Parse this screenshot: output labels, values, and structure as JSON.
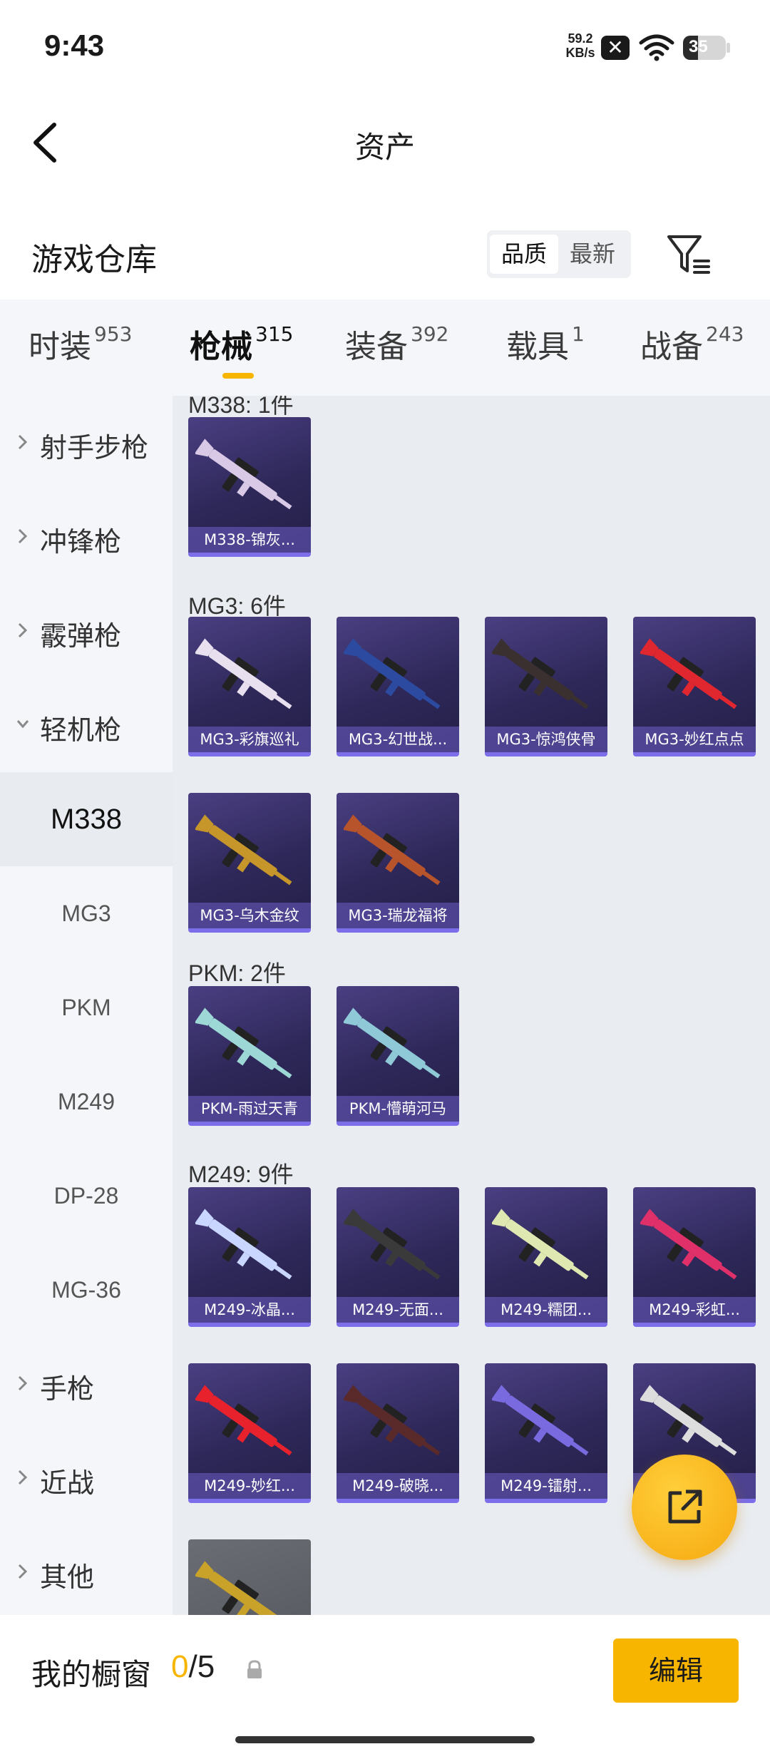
{
  "status_bar": {
    "time": "9:43",
    "net_speed_value": "59.2",
    "net_speed_unit": "KB/s",
    "battery": "35",
    "battery_level": 0.35
  },
  "nav": {
    "title": "资产",
    "back_icon": "chevron-left-icon"
  },
  "section": {
    "title": "游戏仓库",
    "sort_options": [
      "品质",
      "最新"
    ],
    "active_sort": "品质",
    "filter_icon": "filter-icon"
  },
  "tabs": [
    {
      "label": "时装",
      "count": "953"
    },
    {
      "label": "枪械",
      "count": "315"
    },
    {
      "label": "装备",
      "count": "392"
    },
    {
      "label": "载具",
      "count": "1"
    },
    {
      "label": "战备",
      "count": "243"
    }
  ],
  "active_tab": "枪械",
  "sidebar": {
    "categories": [
      "射手步枪",
      "冲锋枪",
      "霰弹枪",
      "轻机枪"
    ],
    "subcategories": [
      "M338",
      "MG3",
      "PKM",
      "M249",
      "DP-28",
      "MG-36"
    ],
    "active_sub": "M338",
    "more_categories": [
      "手枪",
      "近战",
      "其他"
    ]
  },
  "groups": [
    {
      "title": "M338: 1件",
      "items": [
        "M338-锦灰..."
      ]
    },
    {
      "title": "MG3: 6件",
      "items": [
        "MG3-彩旗巡礼",
        "MG3-幻世战...",
        "MG3-惊鸿侠骨",
        "MG3-妙红点点",
        "MG3-乌木金纹",
        "MG3-瑞龙福将"
      ]
    },
    {
      "title": "PKM: 2件",
      "items": [
        "PKM-雨过天青",
        "PKM-懵萌河马"
      ]
    },
    {
      "title": "M249: 9件",
      "items": [
        "M249-冰晶...",
        "M249-无面...",
        "M249-糯团...",
        "M249-彩虹...",
        "M249-妙红...",
        "M249-破晓...",
        "M249-镭射...",
        "",
        ""
      ]
    }
  ],
  "gun_colors": {
    "m338": "#d9c9e6",
    "mg3": [
      "#e8e0ee",
      "#2b4aa0",
      "#3a3030",
      "#e0262e",
      "#c7962a",
      "#b8542c"
    ],
    "pkm": [
      "#9ed8d6",
      "#8fc9d8"
    ],
    "m249": [
      "#c9d6ff",
      "#3a3a3a",
      "#dfe8b0",
      "#e0306a",
      "#e8222c",
      "#5a2a2a",
      "#7a6ae0",
      "#ddd",
      "#c9a22a"
    ]
  },
  "fab": {
    "icon": "share-out-icon"
  },
  "bottom_bar": {
    "label": "我的橱窗",
    "count_current": "0",
    "count_total": "/5",
    "lock_icon": "lock-icon",
    "edit_label": "编辑"
  },
  "accent": "#f7b500"
}
